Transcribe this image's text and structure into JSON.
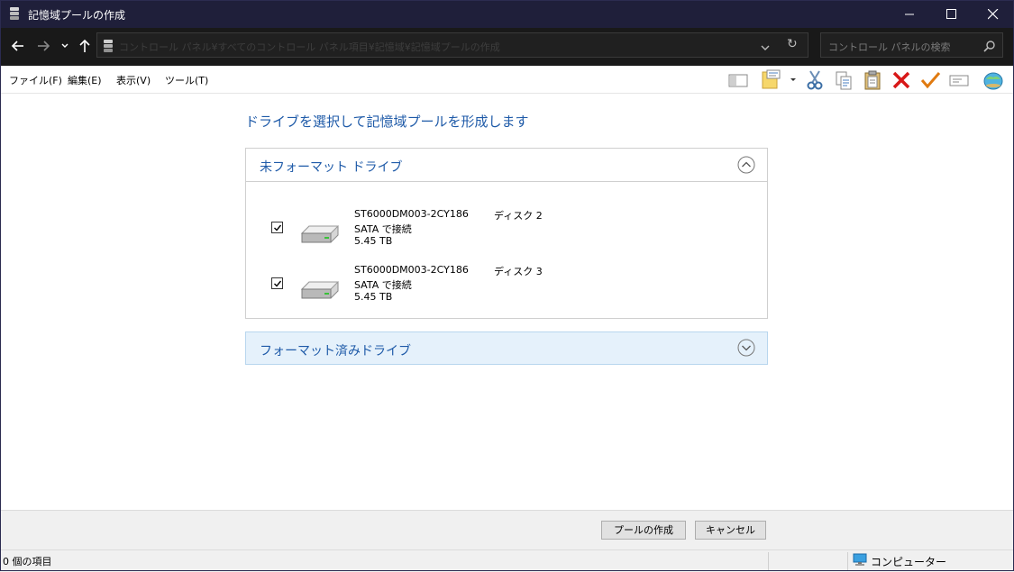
{
  "window": {
    "title": "記憶域プールの作成",
    "icon": "storage-pool-icon",
    "controls": [
      "minimize-icon",
      "maximize-icon",
      "close-icon"
    ]
  },
  "nav": {
    "address_path": "コントロール パネル¥すべてのコントロール パネル項目¥記憶域¥記憶域プールの作成",
    "search_placeholder": "コントロール パネルの検索"
  },
  "menu": {
    "items": [
      "ファイル(F)",
      "編集(E)",
      "表示(V)",
      "ツール(T)"
    ]
  },
  "toolbar": {
    "icons": [
      "pane-icon",
      "properties-icon",
      "cut-icon",
      "copy-icon",
      "paste-icon",
      "delete-icon",
      "check-icon",
      "rename-icon",
      "globe-icon"
    ]
  },
  "main": {
    "heading": "ドライブを選択して記憶域プールを形成します",
    "unformatted_group": {
      "title": "未フォーマット ドライブ",
      "drives": [
        {
          "name": "ST6000DM003-2CY186",
          "connection": "SATA で接続",
          "size": "5.45 TB",
          "disk": "ディスク 2",
          "checked": true
        },
        {
          "name": "ST6000DM003-2CY186",
          "connection": "SATA で接続",
          "size": "5.45 TB",
          "disk": "ディスク 3",
          "checked": true
        }
      ]
    },
    "formatted_group": {
      "title": "フォーマット済みドライブ"
    }
  },
  "buttons": {
    "create": "プールの作成",
    "cancel": "キャンセル"
  },
  "status": {
    "items_count": "0 個の項目",
    "location": "コンピューター"
  },
  "colors": {
    "titlebar": "#1f1f3a",
    "link_blue": "#1e5aa8",
    "formatted_bg": "#e5f1fb"
  }
}
